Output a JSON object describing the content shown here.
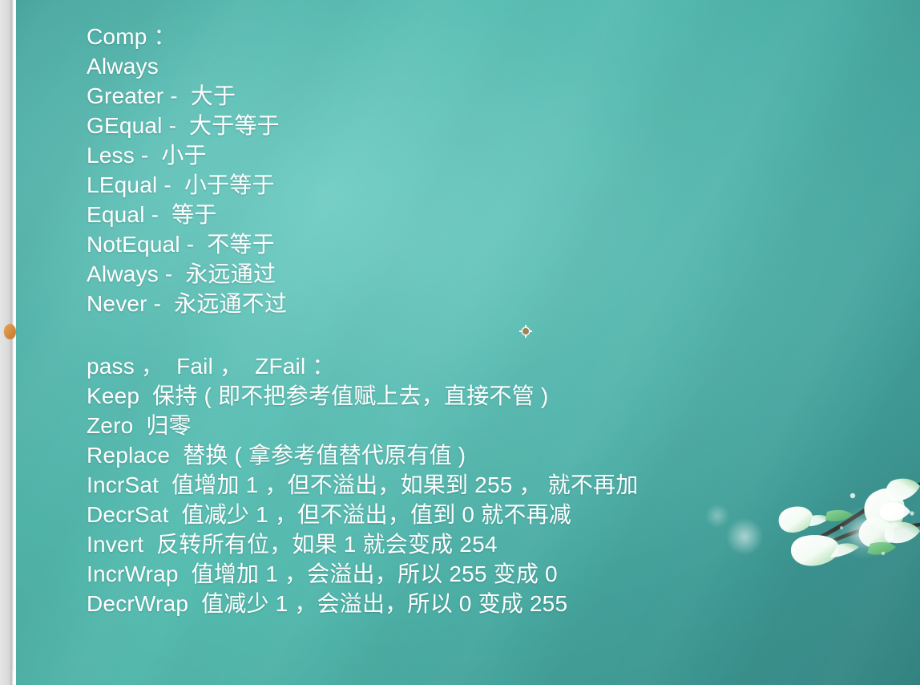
{
  "slide": {
    "background_color_light": "#57bdb1",
    "background_color_dark": "#368a88",
    "text_color": "#ffffff"
  },
  "block_a": {
    "heading": "Comp ：",
    "lines": [
      "Always",
      "Greater -  大于",
      "GEqual -  大于等于",
      "Less -  小于",
      "LEqual -  小于等于",
      "Equal -  等于",
      "NotEqual -  不等于",
      "Always -  永远通过",
      "Never -  永远通不过"
    ]
  },
  "block_b": {
    "heading": "pass ，  Fail ，  ZFail ：",
    "lines": [
      "Keep  保持 ( 即不把参考值赋上去，直接不管 )",
      "Zero  归零",
      "Replace  替换 ( 拿参考值替代原有值 )",
      "IncrSat  值增加 1 ，但不溢出，如果到 255 ， 就不再加",
      "DecrSat  值减少 1 ，但不溢出，值到 0 就不再减",
      "Invert  反转所有位，如果 1 就会变成 254",
      "IncrWrap  值增加 1 ，会溢出，所以 255 变成 0",
      "DecrWrap  值减少 1 ，会溢出，所以 0 变成 255"
    ]
  },
  "decoration": {
    "name": "magnolia-branch",
    "petal_color": "#ffffff",
    "leaf_color": "#7fc98a",
    "branch_color": "#3a3a38"
  },
  "markers": {
    "edge_marker_color": "#d98b3e",
    "crosshair_color": "#a08354"
  }
}
